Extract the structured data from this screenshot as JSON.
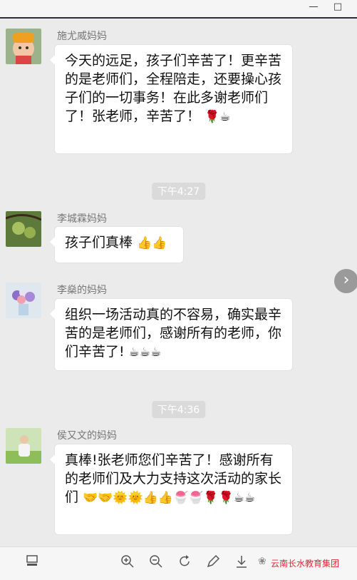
{
  "window": {
    "minimize_icon": "—",
    "maximize_icon": "□"
  },
  "messages": [
    {
      "sender": "施尤威妈妈",
      "text": "今天的远足，孩子们辛苦了！更辛苦的是老师们，全程陪走，还要操心孩子们的一切事务！在此多谢老师们了！张老师，辛苦了！",
      "emoji": "🌹☕"
    },
    {
      "sender": "李城霖妈妈",
      "text": "孩子们真棒",
      "emoji": "👍👍"
    },
    {
      "sender": "李燊的妈妈",
      "text": "组织一场活动真的不容易，确实最辛苦的是老师们，感谢所有的老师，你们辛苦了!",
      "emoji": "☕☕☕"
    },
    {
      "sender": "侯又文的妈妈",
      "text": "真棒!张老师您们辛苦了！感谢所有的老师们及大力支持这次活动的家长们",
      "emoji": "🤝🤝🌞🌞👍👍🍧🍧🌹🌹☕☕"
    }
  ],
  "timestamps": [
    "下午4:27",
    "下午4:36"
  ],
  "toolbar": {
    "icons": [
      "screen-icon",
      "zoom-in-icon",
      "zoom-out-icon",
      "rotate-icon",
      "edit-icon",
      "download-icon"
    ]
  },
  "watermark": {
    "text": "云南长水教育集团"
  }
}
